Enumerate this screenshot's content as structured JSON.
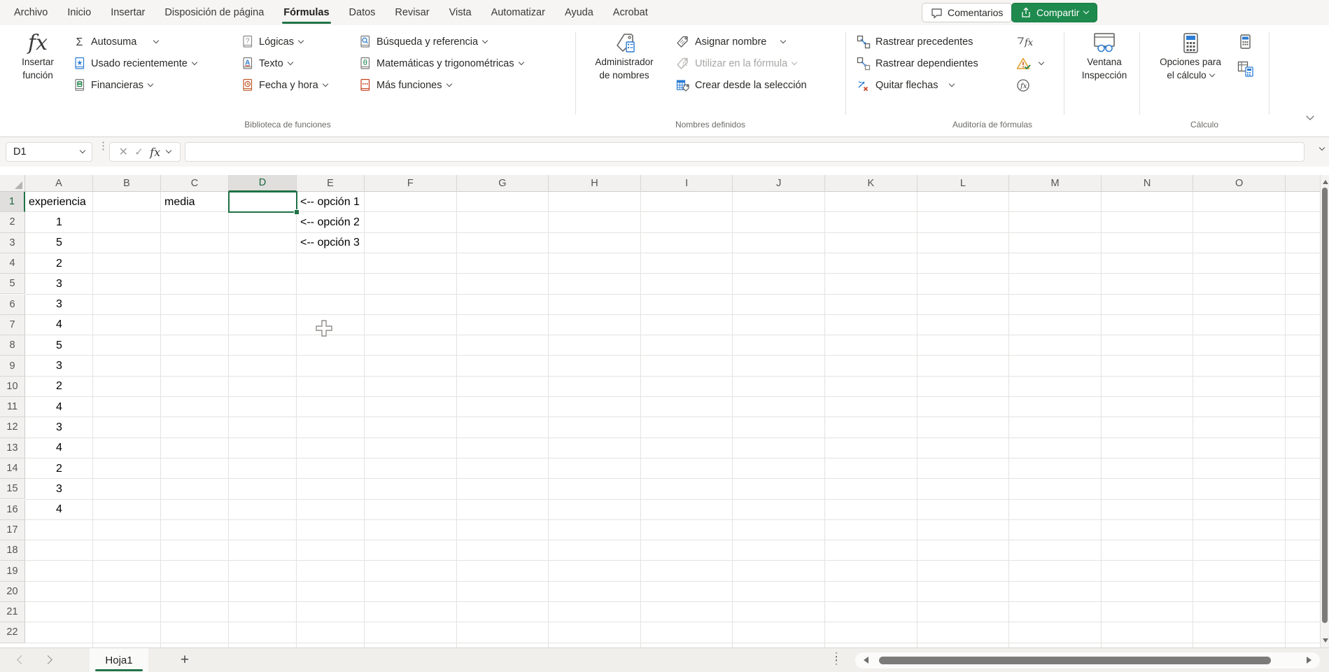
{
  "menu": {
    "tabs": [
      {
        "label": "Archivo",
        "active": false
      },
      {
        "label": "Inicio",
        "active": false
      },
      {
        "label": "Insertar",
        "active": false
      },
      {
        "label": "Disposición de página",
        "active": false
      },
      {
        "label": "Fórmulas",
        "active": true
      },
      {
        "label": "Datos",
        "active": false
      },
      {
        "label": "Revisar",
        "active": false
      },
      {
        "label": "Vista",
        "active": false
      },
      {
        "label": "Automatizar",
        "active": false
      },
      {
        "label": "Ayuda",
        "active": false
      },
      {
        "label": "Acrobat",
        "active": false
      }
    ],
    "comments_label": "Comentarios",
    "share_label": "Compartir"
  },
  "ribbon": {
    "insert1": "Insertar",
    "insert2": "función",
    "library": {
      "autosum": "Autosuma",
      "recent": "Usado recientemente",
      "financial": "Financieras",
      "logical": "Lógicas",
      "text": "Texto",
      "datetime": "Fecha y hora",
      "lookup": "Búsqueda y referencia",
      "math": "Matemáticas y trigonométricas",
      "more": "Más funciones",
      "group": "Biblioteca de funciones"
    },
    "names": {
      "manager1": "Administrador",
      "manager2": "de nombres",
      "define": "Asignar nombre",
      "use": "Utilizar en la fórmula",
      "create": "Crear desde la selección",
      "group": "Nombres definidos"
    },
    "audit": {
      "precedents": "Rastrear precedentes",
      "dependents": "Rastrear dependientes",
      "remove": "Quitar flechas",
      "watch1": "Ventana",
      "watch2": "Inspección",
      "group": "Auditoría de fórmulas"
    },
    "calc": {
      "options1": "Opciones para",
      "options2": "el cálculo",
      "group": "Cálculo"
    }
  },
  "formula_bar": {
    "name_box": "D1"
  },
  "sheet": {
    "columns": [
      "A",
      "B",
      "C",
      "D",
      "E",
      "F",
      "G",
      "H",
      "I",
      "J",
      "K",
      "L",
      "M",
      "N",
      "O",
      ""
    ],
    "row_numbers": [
      "1",
      "2",
      "3",
      "4",
      "5",
      "6",
      "7",
      "8",
      "9",
      "10",
      "11",
      "12",
      "13",
      "14",
      "15",
      "16",
      "17",
      "18",
      "19",
      "20",
      "21",
      "22"
    ],
    "selected": {
      "ref": "D1",
      "col": "D",
      "row": 1
    },
    "cells": [
      {
        "ref": "A1",
        "col": "A",
        "row": 1,
        "value": "experiencia",
        "align": "left"
      },
      {
        "ref": "C1",
        "col": "C",
        "row": 1,
        "value": "media",
        "align": "left"
      },
      {
        "ref": "E1",
        "col": "E",
        "row": 1,
        "value": "<-- opción 1",
        "align": "left"
      },
      {
        "ref": "E2",
        "col": "E",
        "row": 2,
        "value": "<-- opción 2",
        "align": "left"
      },
      {
        "ref": "E3",
        "col": "E",
        "row": 3,
        "value": "<-- opción 3",
        "align": "left"
      },
      {
        "ref": "A2",
        "col": "A",
        "row": 2,
        "value": "1",
        "align": "center"
      },
      {
        "ref": "A3",
        "col": "A",
        "row": 3,
        "value": "5",
        "align": "center"
      },
      {
        "ref": "A4",
        "col": "A",
        "row": 4,
        "value": "2",
        "align": "center"
      },
      {
        "ref": "A5",
        "col": "A",
        "row": 5,
        "value": "3",
        "align": "center"
      },
      {
        "ref": "A6",
        "col": "A",
        "row": 6,
        "value": "3",
        "align": "center"
      },
      {
        "ref": "A7",
        "col": "A",
        "row": 7,
        "value": "4",
        "align": "center"
      },
      {
        "ref": "A8",
        "col": "A",
        "row": 8,
        "value": "5",
        "align": "center"
      },
      {
        "ref": "A9",
        "col": "A",
        "row": 9,
        "value": "3",
        "align": "center"
      },
      {
        "ref": "A10",
        "col": "A",
        "row": 10,
        "value": "2",
        "align": "center"
      },
      {
        "ref": "A11",
        "col": "A",
        "row": 11,
        "value": "4",
        "align": "center"
      },
      {
        "ref": "A12",
        "col": "A",
        "row": 12,
        "value": "3",
        "align": "center"
      },
      {
        "ref": "A13",
        "col": "A",
        "row": 13,
        "value": "4",
        "align": "center"
      },
      {
        "ref": "A14",
        "col": "A",
        "row": 14,
        "value": "2",
        "align": "center"
      },
      {
        "ref": "A15",
        "col": "A",
        "row": 15,
        "value": "3",
        "align": "center"
      },
      {
        "ref": "A16",
        "col": "A",
        "row": 16,
        "value": "4",
        "align": "center"
      }
    ],
    "tab": "Hoja1"
  },
  "colors": {
    "accent_green": "#217346",
    "share_green": "#1e8a4e",
    "selection_border": "#1e7145"
  }
}
